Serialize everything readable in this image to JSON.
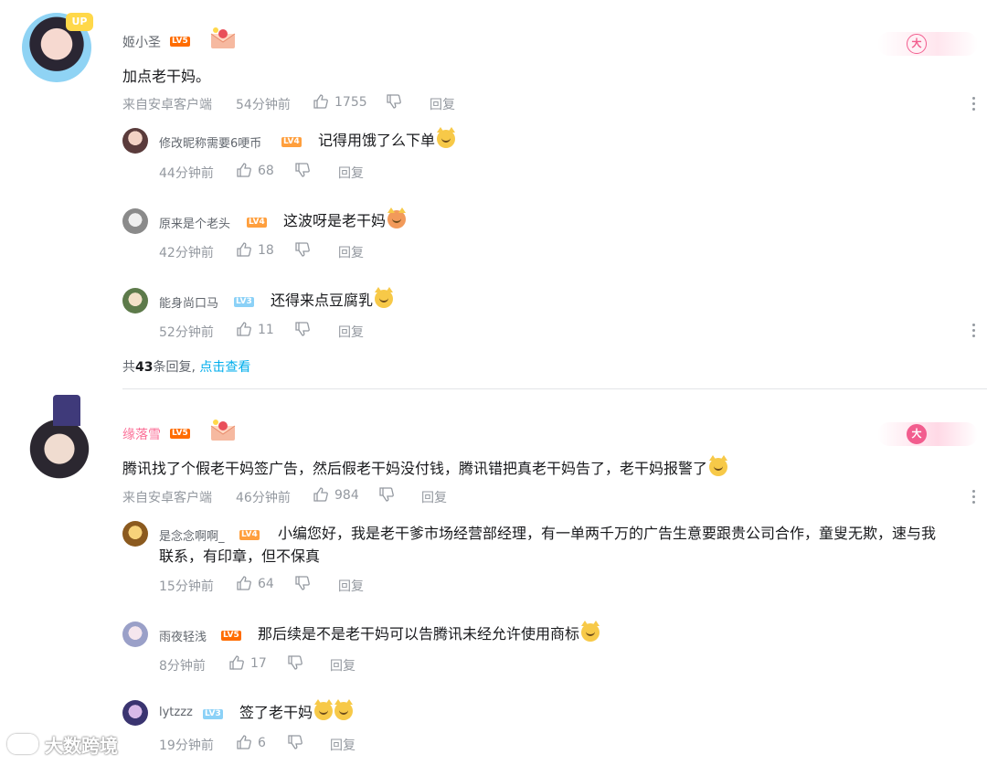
{
  "comments": [
    {
      "user": "姬小圣",
      "level": "LV5",
      "content": "加点老干妈。",
      "source": "来自安卓客户端",
      "time": "54分钟前",
      "likes": "1755",
      "reply_label": "回复",
      "replies": [
        {
          "user": "修改昵称需要6哽币",
          "level": "LV4",
          "content": "记得用饿了么下单",
          "time": "44分钟前",
          "likes": "68",
          "reply_label": "回复"
        },
        {
          "user": "原来是个老头",
          "level": "LV4",
          "content": "这波呀是老干妈",
          "time": "42分钟前",
          "likes": "18",
          "reply_label": "回复"
        },
        {
          "user": "能身尚口马",
          "level": "LV3",
          "content": "还得来点豆腐乳",
          "time": "52分钟前",
          "likes": "11",
          "reply_label": "回复"
        }
      ],
      "summary_prefix": "共",
      "summary_count": "43",
      "summary_suffix": "条回复,",
      "summary_link": "点击查看"
    },
    {
      "user": "缘落雪",
      "level": "LV5",
      "content": "腾讯找了个假老干妈签广告，然后假老干妈没付钱，腾讯错把真老干妈告了，老干妈报警了",
      "source": "来自安卓客户端",
      "time": "46分钟前",
      "likes": "984",
      "reply_label": "回复",
      "replies": [
        {
          "user": "是念念啊啊_",
          "level": "LV4",
          "content_line1": "小编您好，我是老干爹市场经营部经理，有一单两千万的广告生意要跟贵公司合作，童叟无欺，速与我",
          "content_line2": "联系，有印章，但不保真",
          "time": "15分钟前",
          "likes": "64",
          "reply_label": "回复"
        },
        {
          "user": "雨夜轻浅",
          "level": "LV5",
          "content": "那后续是不是老干妈可以告腾讯未经允许使用商标",
          "time": "8分钟前",
          "likes": "17",
          "reply_label": "回复"
        },
        {
          "user": "lytzzz",
          "level": "LV3",
          "content": "签了老干妈",
          "time": "19分钟前",
          "likes": "6",
          "reply_label": "回复"
        }
      ]
    }
  ],
  "fan_badge": "大",
  "watermark": "大数跨境",
  "colors": {
    "lv5": "#ff6c00",
    "lv4": "#ff9f3d",
    "lv3": "#8bd1f7",
    "accent_pink": "#fb7299",
    "link": "#00aeec"
  },
  "icons": [
    "thumb-up-icon",
    "thumb-down-icon",
    "more-icon",
    "gift-icon",
    "emoji-icon"
  ]
}
